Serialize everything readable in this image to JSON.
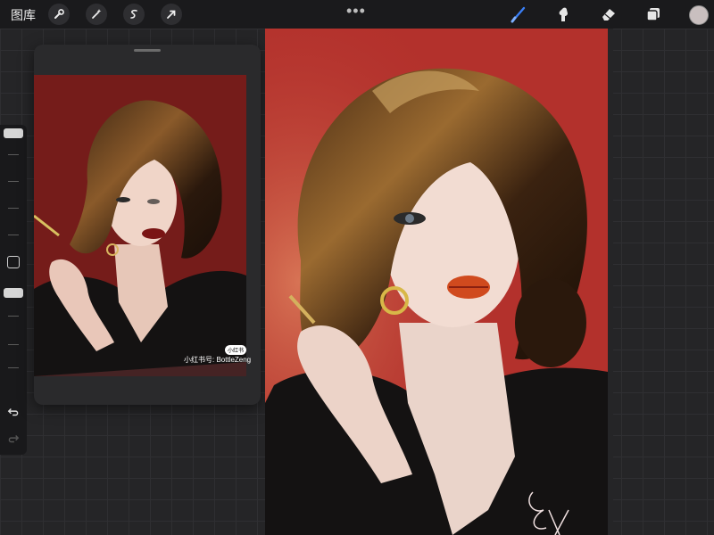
{
  "app": {
    "gallery_label": "图库"
  },
  "toolbar": {
    "left_tools": [
      "wrench-icon",
      "magic-wand-icon",
      "selection-icon",
      "transform-arrow-icon"
    ],
    "more_label": "•••",
    "right_tools": [
      "brush-icon",
      "smudge-icon",
      "eraser-icon",
      "layers-icon"
    ],
    "active_tool": "brush",
    "accent_color": "#3a7ff6",
    "current_color": "#c9bfbf"
  },
  "reference": {
    "watermark": "小红书号: BottleZeng",
    "badge": "小红书"
  },
  "colors": {
    "canvas_red": "#b3312c",
    "ui_dark": "#1a1a1c"
  }
}
